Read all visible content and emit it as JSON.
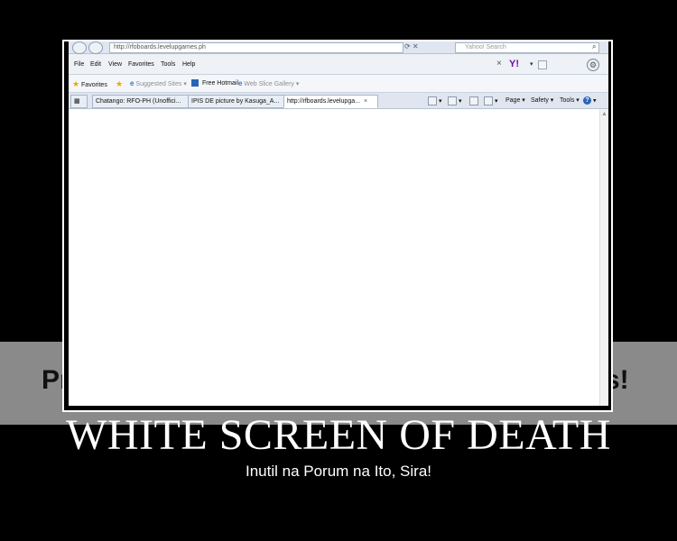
{
  "watermark": {
    "left_text": "Pr",
    "right_text": "s!"
  },
  "browser": {
    "address": "http://rfoboards.levelupgames.ph",
    "search_placeholder": "Yahoo! Search",
    "menu": [
      "File",
      "Edit",
      "View",
      "Favorites",
      "Tools",
      "Help"
    ],
    "yahoo_logo": "Y!",
    "favorites_bar": {
      "favorites": "Favorites",
      "suggested": "Suggested Sites",
      "hotmail": "Free Hotmail",
      "gallery": "Web Slice Gallery"
    },
    "tabs": [
      {
        "label": "Chatango: RFO-PH (Unoffici..."
      },
      {
        "label": "IPIS DE picture by Kasuga_A..."
      },
      {
        "label": "http://rfboards.levelupga..."
      }
    ],
    "toolbar": {
      "page": "Page",
      "safety": "Safety",
      "tools": "Tools"
    },
    "icons": {
      "home": "home-icon",
      "feeds": "feeds-icon",
      "mail": "mail-icon",
      "print": "print-icon",
      "help": "help-icon",
      "settings": "gear-icon"
    }
  },
  "poster": {
    "title": "WHITE SCREEN OF DEATH",
    "subtitle": "Inutil na Porum na Ito, Sira!"
  }
}
